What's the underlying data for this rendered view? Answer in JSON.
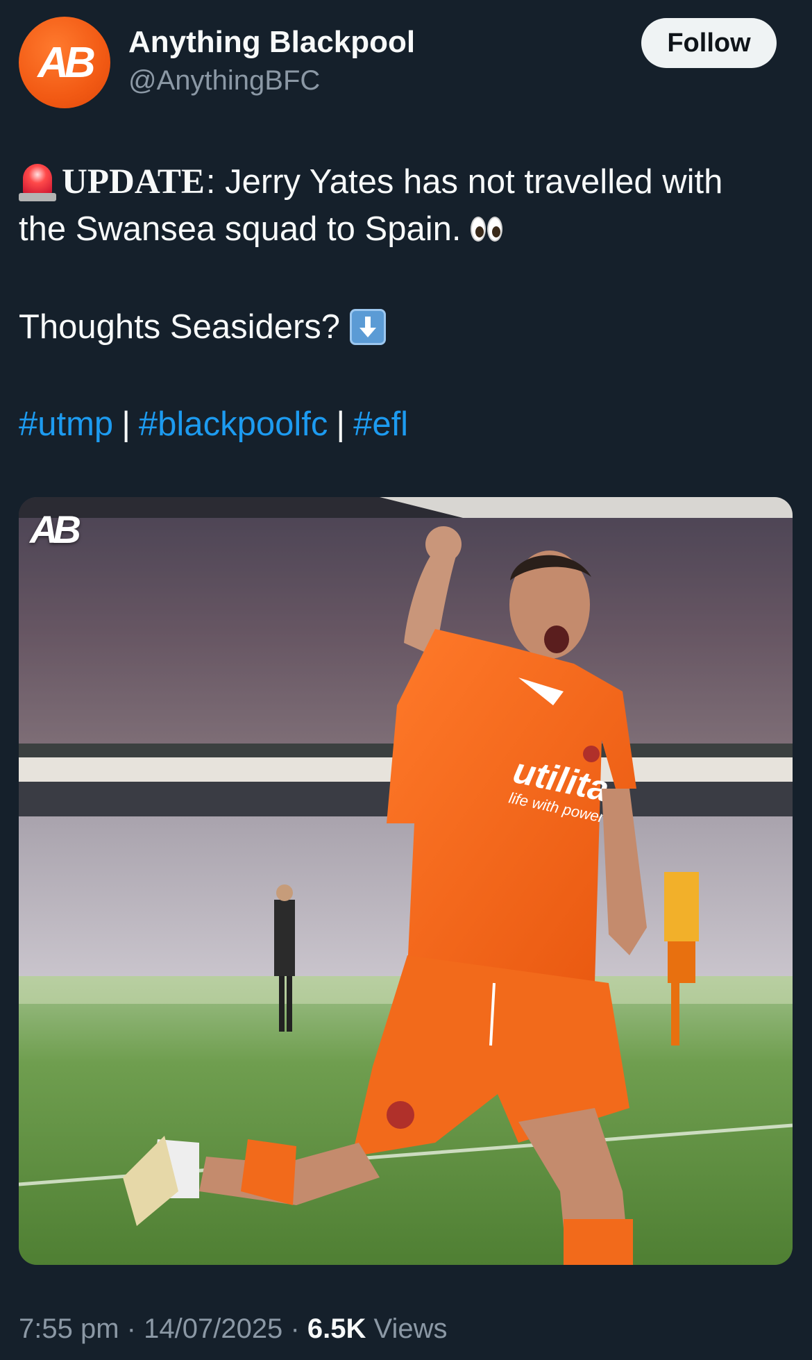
{
  "author": {
    "avatar_text": "AB",
    "name": "Anything Blackpool",
    "handle": "@AnythingBFC",
    "follow_label": "Follow"
  },
  "post": {
    "update_word": "UPDATE",
    "line1_rest": ": Jerry Yates has not travelled with",
    "line2": "the Swansea squad to Spain.",
    "line3": "Thoughts Seasiders?",
    "hashtags": [
      "#utmp",
      "#blackpoolfc",
      "#efl"
    ],
    "separator": "|"
  },
  "media": {
    "watermark": "AB",
    "sponsor_text": "utilita",
    "sponsor_tagline": "life with power"
  },
  "footer": {
    "time": "7:55 pm",
    "date": "14/07/2025",
    "views_count": "6.5K",
    "views_label": "Views",
    "dot": "·"
  },
  "colors": {
    "background": "#15202b",
    "hashtag": "#1d9bf0",
    "secondary_text": "#8b98a5",
    "avatar": "#f25a14",
    "kit_orange": "#f26a1b"
  },
  "icons": [
    "siren-icon",
    "eyes-emoji-icon",
    "down-arrow-emoji-icon"
  ]
}
